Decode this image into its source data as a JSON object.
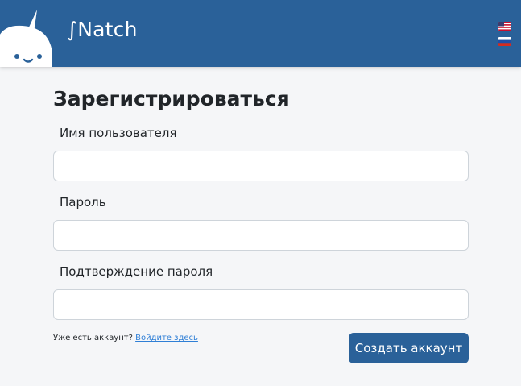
{
  "header": {
    "brand": "∫Natch",
    "brand_color": "#2a6199",
    "languages": [
      {
        "code": "en",
        "icon": "us-flag-icon"
      },
      {
        "code": "ru",
        "icon": "ru-flag-icon"
      }
    ]
  },
  "form": {
    "title": "Зарегистрироваться",
    "fields": [
      {
        "label": "Имя пользователя",
        "value": "",
        "placeholder": ""
      },
      {
        "label": "Пароль",
        "value": "",
        "placeholder": ""
      },
      {
        "label": "Подтверждение пароля",
        "value": "",
        "placeholder": ""
      }
    ],
    "login_prompt": "Уже есть аккаунт?",
    "login_link": "Войдите здесь",
    "submit_label": "Создать аккаунт"
  },
  "colors": {
    "accent": "#2a6199",
    "link": "#2f7fd6",
    "background": "#f5f6f8"
  }
}
